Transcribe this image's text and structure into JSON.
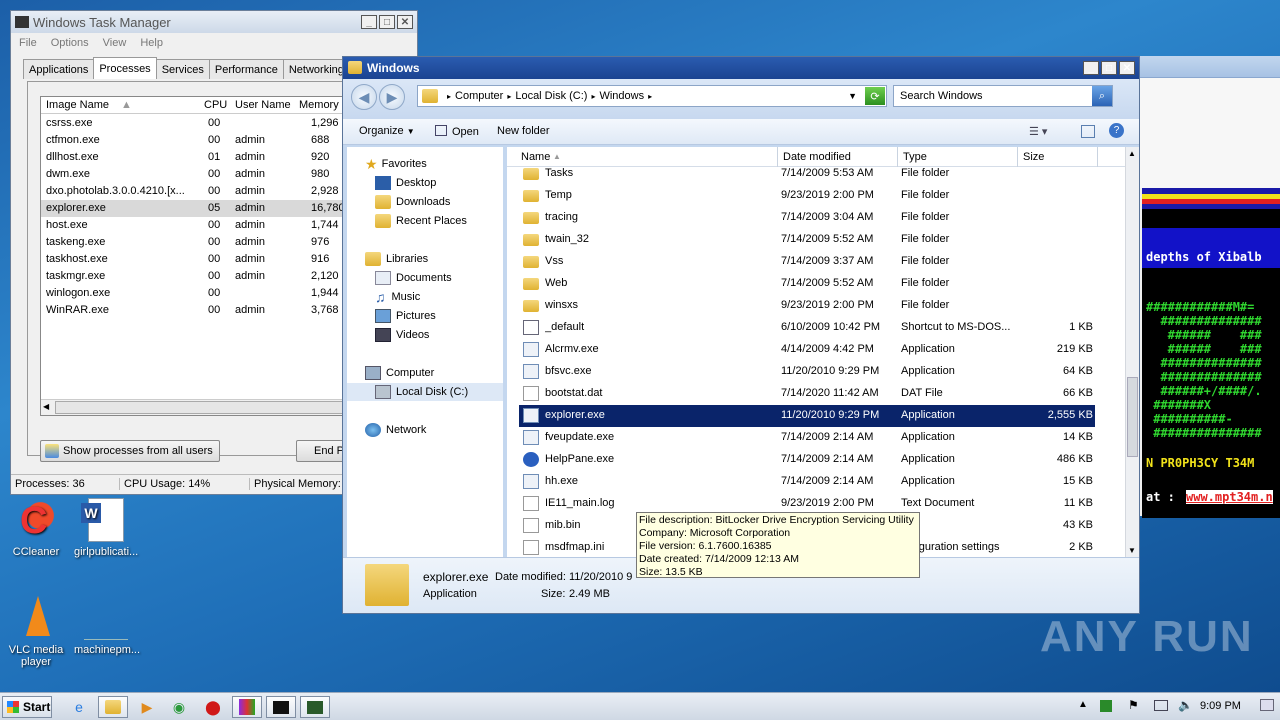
{
  "task_manager": {
    "title": "Windows Task Manager",
    "menu": [
      "File",
      "Options",
      "View",
      "Help"
    ],
    "tabs": [
      "Applications",
      "Processes",
      "Services",
      "Performance",
      "Networking"
    ],
    "active_tab": "Processes",
    "columns": [
      "Image Name",
      "CPU",
      "User Name",
      "Memory ("
    ],
    "processes": [
      {
        "name": "csrss.exe",
        "cpu": "00",
        "user": "",
        "mem": "1,296"
      },
      {
        "name": "ctfmon.exe",
        "cpu": "00",
        "user": "admin",
        "mem": "688"
      },
      {
        "name": "dllhost.exe",
        "cpu": "01",
        "user": "admin",
        "mem": "920"
      },
      {
        "name": "dwm.exe",
        "cpu": "00",
        "user": "admin",
        "mem": "980"
      },
      {
        "name": "dxo.photolab.3.0.0.4210.[x...",
        "cpu": "00",
        "user": "admin",
        "mem": "2,928"
      },
      {
        "name": "explorer.exe",
        "cpu": "05",
        "user": "admin",
        "mem": "16,780"
      },
      {
        "name": "host.exe",
        "cpu": "00",
        "user": "admin",
        "mem": "1,744"
      },
      {
        "name": "taskeng.exe",
        "cpu": "00",
        "user": "admin",
        "mem": "976"
      },
      {
        "name": "taskhost.exe",
        "cpu": "00",
        "user": "admin",
        "mem": "916"
      },
      {
        "name": "taskmgr.exe",
        "cpu": "00",
        "user": "admin",
        "mem": "2,120"
      },
      {
        "name": "winlogon.exe",
        "cpu": "00",
        "user": "",
        "mem": "1,944"
      },
      {
        "name": "WinRAR.exe",
        "cpu": "00",
        "user": "admin",
        "mem": "3,768"
      }
    ],
    "show_all_button": "Show processes from all users",
    "end_button": "End P",
    "status": {
      "processes": "Processes: 36",
      "cpu": "CPU Usage: 14%",
      "memory": "Physical Memory: 3"
    }
  },
  "explorer": {
    "title": "Windows",
    "breadcrumb": [
      "Computer",
      "Local Disk (C:)",
      "Windows"
    ],
    "search_placeholder": "Search Windows",
    "commands": {
      "organize": "Organize",
      "open": "Open",
      "new_folder": "New folder"
    },
    "nav": {
      "favorites": "Favorites",
      "desktop": "Desktop",
      "downloads": "Downloads",
      "recent": "Recent Places",
      "libraries": "Libraries",
      "documents": "Documents",
      "music": "Music",
      "pictures": "Pictures",
      "videos": "Videos",
      "computer": "Computer",
      "local_disk": "Local Disk (C:)",
      "network": "Network"
    },
    "columns": {
      "name": "Name",
      "date": "Date modified",
      "type": "Type",
      "size": "Size"
    },
    "files": [
      {
        "name": "Tasks",
        "date": "7/14/2009 5:53 AM",
        "type": "File folder",
        "size": "",
        "kind": "folder"
      },
      {
        "name": "Temp",
        "date": "9/23/2019 2:00 PM",
        "type": "File folder",
        "size": "",
        "kind": "folder"
      },
      {
        "name": "tracing",
        "date": "7/14/2009 3:04 AM",
        "type": "File folder",
        "size": "",
        "kind": "folder"
      },
      {
        "name": "twain_32",
        "date": "7/14/2009 5:52 AM",
        "type": "File folder",
        "size": "",
        "kind": "folder"
      },
      {
        "name": "Vss",
        "date": "7/14/2009 3:37 AM",
        "type": "File folder",
        "size": "",
        "kind": "folder"
      },
      {
        "name": "Web",
        "date": "7/14/2009 5:52 AM",
        "type": "File folder",
        "size": "",
        "kind": "folder"
      },
      {
        "name": "winsxs",
        "date": "9/23/2019 2:00 PM",
        "type": "File folder",
        "size": "",
        "kind": "folder"
      },
      {
        "name": "_default",
        "date": "6/10/2009 10:42 PM",
        "type": "Shortcut to MS-DOS...",
        "size": "1 KB",
        "kind": "shortcut"
      },
      {
        "name": "Alcrmv.exe",
        "date": "4/14/2009 4:42 PM",
        "type": "Application",
        "size": "219 KB",
        "kind": "app"
      },
      {
        "name": "bfsvc.exe",
        "date": "11/20/2010 9:29 PM",
        "type": "Application",
        "size": "64 KB",
        "kind": "app"
      },
      {
        "name": "bootstat.dat",
        "date": "7/14/2020 11:42 AM",
        "type": "DAT File",
        "size": "66 KB",
        "kind": "file"
      },
      {
        "name": "explorer.exe",
        "date": "11/20/2010 9:29 PM",
        "type": "Application",
        "size": "2,555 KB",
        "kind": "app"
      },
      {
        "name": "fveupdate.exe",
        "date": "7/14/2009 2:14 AM",
        "type": "Application",
        "size": "14 KB",
        "kind": "app"
      },
      {
        "name": "HelpPane.exe",
        "date": "7/14/2009 2:14 AM",
        "type": "Application",
        "size": "486 KB",
        "kind": "help"
      },
      {
        "name": "hh.exe",
        "date": "7/14/2009 2:14 AM",
        "type": "Application",
        "size": "15 KB",
        "kind": "app"
      },
      {
        "name": "IE11_main.log",
        "date": "9/23/2019 2:00 PM",
        "type": "Text Document",
        "size": "11 KB",
        "kind": "file"
      },
      {
        "name": "mib.bin",
        "date": "",
        "type": "File",
        "size": "43 KB",
        "kind": "file"
      },
      {
        "name": "msdfmap.ini",
        "date": "",
        "type": "onfiguration settings",
        "size": "2 KB",
        "kind": "file"
      }
    ],
    "selected_file": "explorer.exe",
    "details": {
      "name": "explorer.exe",
      "date_label": "Date modified:",
      "date": "11/20/2010 9",
      "type": "Application",
      "size_label": "Size:",
      "size": "2.49 MB"
    },
    "tooltip": [
      "File description: BitLocker Drive Encryption Servicing Utility",
      "Company: Microsoft Corporation",
      "File version: 6.1.7600.16385",
      "Date created: 7/14/2009 12:13 AM",
      "Size: 13.5 KB"
    ]
  },
  "console_window": {
    "lines": [
      "depths of Xibalb",
      "############M#=",
      "  ##############",
      "   ######    ###",
      "   ######    ###",
      "  ##############",
      "  ##############",
      "  ######+/####/.",
      " #######X",
      " ##########-",
      " ###############",
      "N PR0PH3CY T34M",
      "at : "
    ],
    "link": "www.mpt34m.n"
  },
  "desktop_icons": [
    {
      "label": "CCleaner"
    },
    {
      "label": "girlpublicati..."
    },
    {
      "label": "VLC media player"
    },
    {
      "label": "machinepm..."
    }
  ],
  "watermark": "ANY RUN",
  "taskbar": {
    "start": "Start",
    "clock": "9:09 PM"
  }
}
